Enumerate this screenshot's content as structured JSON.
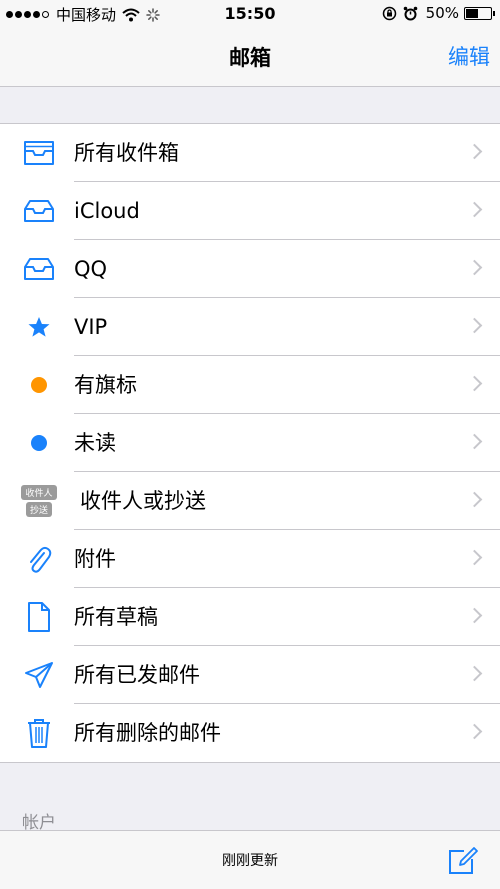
{
  "status_bar": {
    "carrier": "中国移动",
    "time": "15:50",
    "battery_text": "50%",
    "battery_level": 0.5
  },
  "nav": {
    "title": "邮箱",
    "edit_label": "编辑"
  },
  "mailboxes": [
    {
      "label": "所有收件箱",
      "icon": "inbox-icon"
    },
    {
      "label": "iCloud",
      "icon": "inbox-icon"
    },
    {
      "label": "QQ",
      "icon": "inbox-icon"
    },
    {
      "label": "VIP",
      "icon": "star-icon"
    },
    {
      "label": "有旗标",
      "icon": "flag-dot-icon"
    },
    {
      "label": "未读",
      "icon": "unread-dot-icon"
    },
    {
      "label": "收件人或抄送",
      "icon": "to-cc-icon",
      "badge_top": "收件人",
      "badge_bottom": "抄送"
    },
    {
      "label": "附件",
      "icon": "paperclip-icon"
    },
    {
      "label": "所有草稿",
      "icon": "document-icon"
    },
    {
      "label": "所有已发邮件",
      "icon": "paper-plane-icon"
    },
    {
      "label": "所有删除的邮件",
      "icon": "trash-icon"
    }
  ],
  "section_header": "帐户",
  "toolbar": {
    "status": "刚刚更新"
  },
  "colors": {
    "accent": "#1a82fb",
    "flag": "#ff9500",
    "unread": "#1a82fb"
  }
}
